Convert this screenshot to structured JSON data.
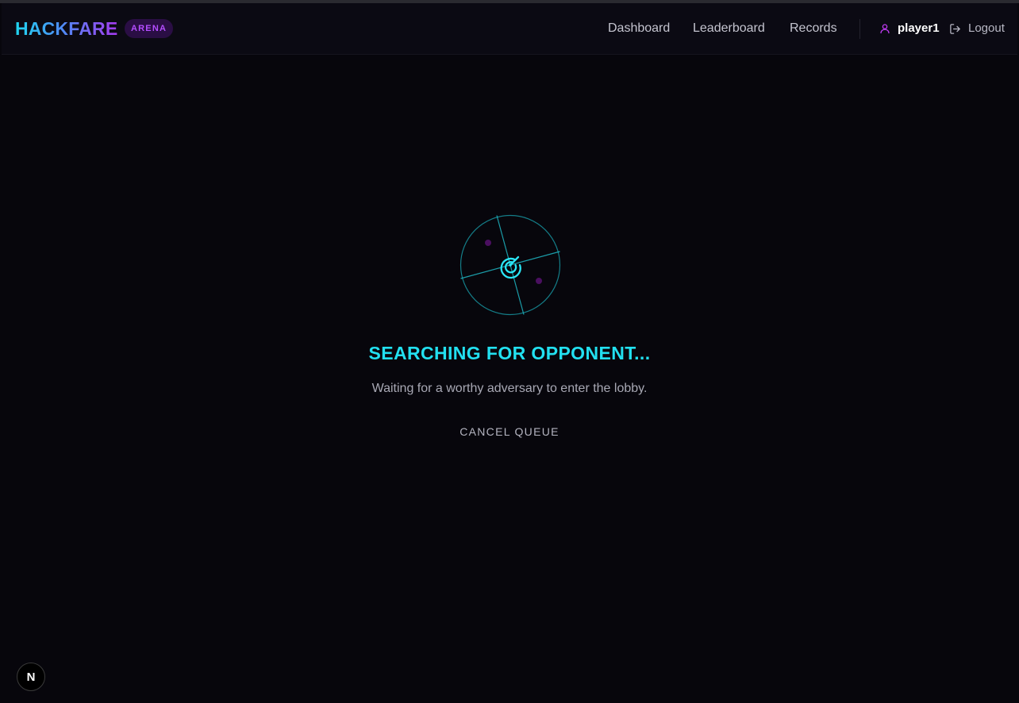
{
  "header": {
    "logo": "HACKFARE",
    "badge": "ARENA",
    "nav": [
      "Dashboard",
      "Leaderboard",
      "Records"
    ],
    "username": "player1",
    "logout_label": "Logout"
  },
  "main": {
    "title": "SEARCHING FOR OPPONENT...",
    "subtitle": "Waiting for a worthy adversary to enter the lobby.",
    "cancel_label": "CANCEL QUEUE"
  },
  "dev_badge": "N",
  "icons": {
    "radar": "radar-icon",
    "user": "user-icon",
    "logout": "logout-icon"
  },
  "colors": {
    "accent_cyan": "#22e0f0",
    "accent_purple": "#a53bf0",
    "background": "#07060c"
  }
}
